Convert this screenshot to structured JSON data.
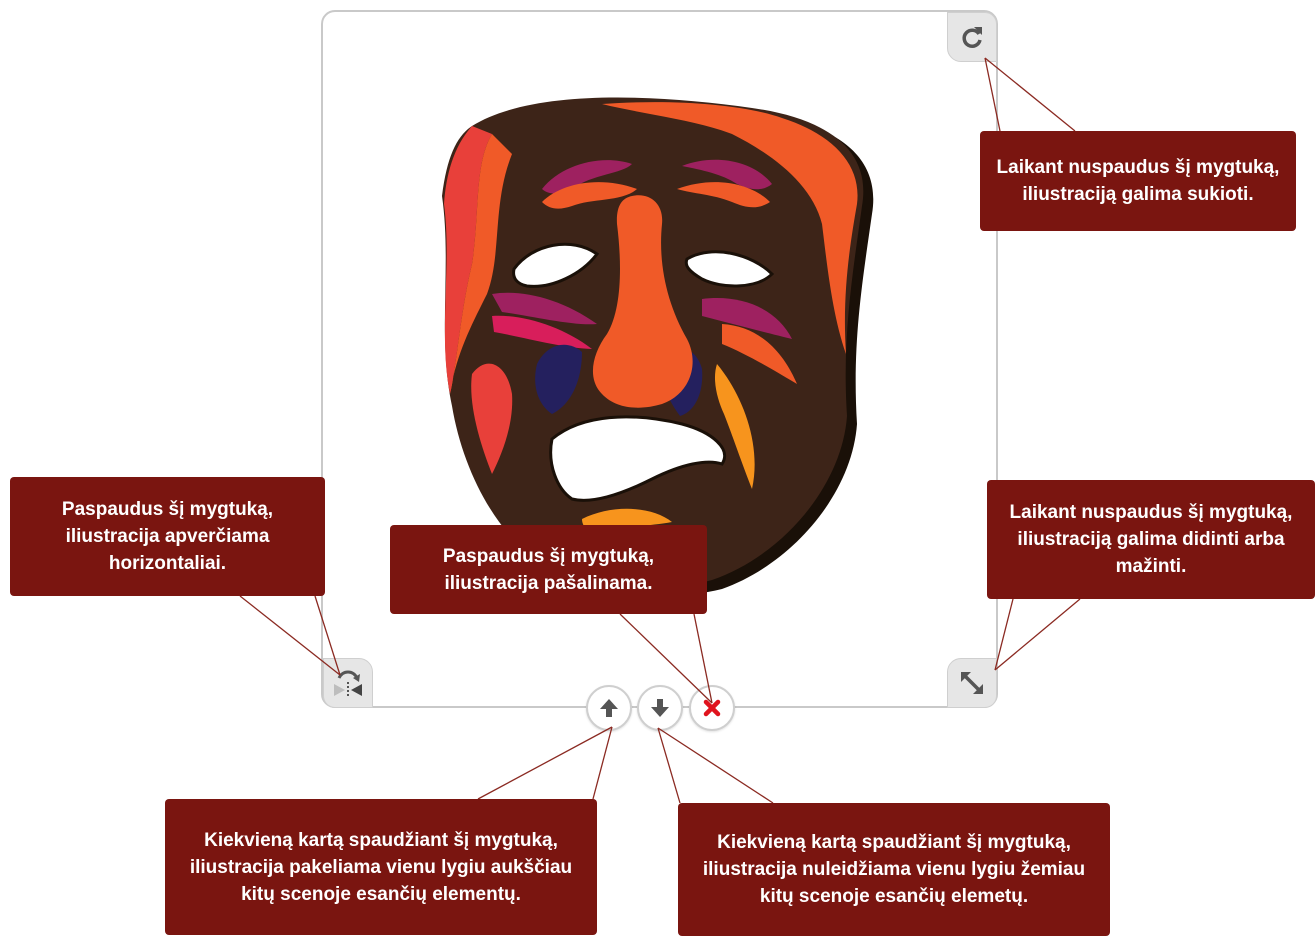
{
  "editor": {
    "image_name": "tragedy-mask-illustration",
    "buttons": {
      "rotate": "rotate-icon",
      "resize": "resize-icon",
      "flip": "flip-horizontal-icon",
      "bring_forward": "arrow-up-icon",
      "send_backward": "arrow-down-icon",
      "delete": "close-icon"
    }
  },
  "callouts": {
    "rotate": "Laikant nuspaudus šį mygtuką,\niliustraciją galima sukioti.",
    "resize": "Laikant nuspaudus šį mygtuką,\niliustraciją galima didinti arba\nmažinti.",
    "flip": "Paspaudus šį mygtuką,\niliustracija apverčiama\nhorizontaliai.",
    "delete": "Paspaudus šį mygtuką,\niliustracija pašalinama.",
    "bring_forward": "Kiekvieną kartą spaudžiant šį mygtuką,\niliustracija pakeliama vienu lygiu aukščiau\nkitų scenoje esančių elementų.",
    "send_backward": "Kiekvieną kartą spaudžiant šį mygtuką,\niliustracija nuleidžiama vienu lygiu žemiau\nkitų scenoje esančių elemetų."
  },
  "colors": {
    "callout_bg": "#7a1510",
    "callout_text": "#ffffff",
    "leader_line": "#8b2a22",
    "delete_icon": "#e0141e",
    "mask_brown": "#3d2418",
    "mask_orange": "#f05a28",
    "mask_red": "#e8403a",
    "mask_magenta": "#9e2160",
    "mask_pink": "#d81e5b",
    "mask_navy": "#24205e",
    "mask_yellow": "#f7941d"
  }
}
